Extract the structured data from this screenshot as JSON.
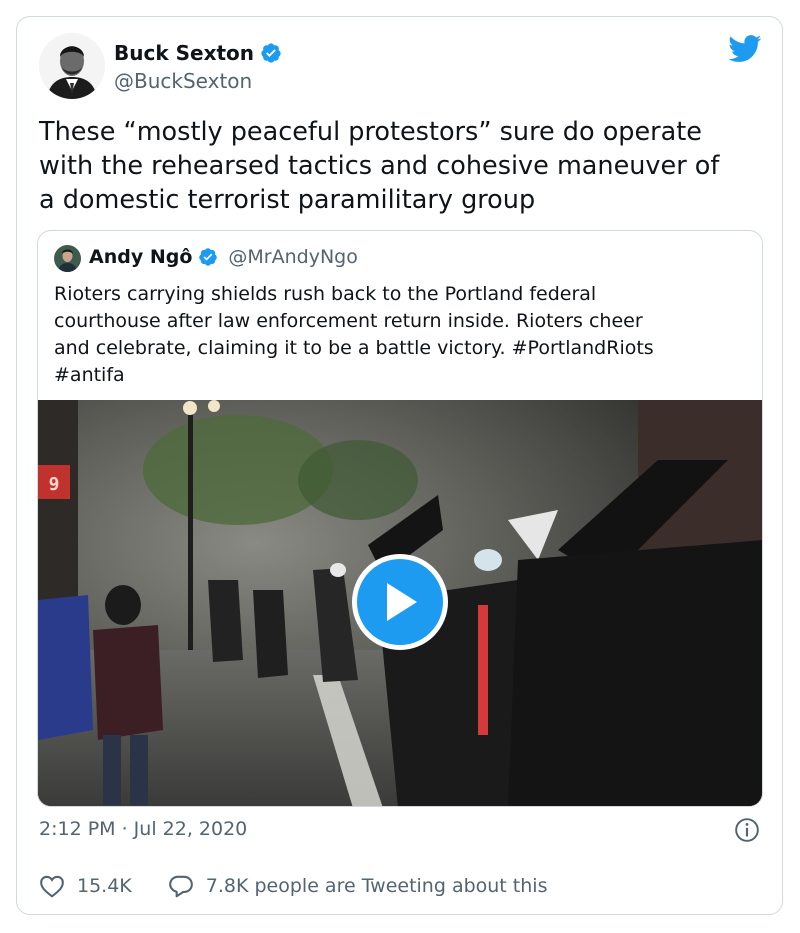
{
  "author": {
    "display_name": "Buck Sexton",
    "handle": "@BuckSexton",
    "verified": true,
    "avatar_icon": "avatar-photo"
  },
  "tweet": {
    "text": "These “mostly peaceful protestors” sure do operate\nwith the rehearsed  tactics and cohesive maneuver of\na domestic terrorist paramilitary group",
    "timestamp": "2:12 PM · Jul 22, 2020"
  },
  "quoted": {
    "display_name": "Andy Ngô",
    "handle": "@MrAndyNgo",
    "verified": true,
    "text": "Rioters carrying shields rush back to the Portland federal\ncourthouse after law enforcement return inside. Rioters cheer\nand celebrate, claiming it to be a battle victory. #PortlandRiots\n #antifa",
    "media_sign_text": "9"
  },
  "stats": {
    "likes": "15.4K",
    "conversation": "7.8K people are Tweeting about this"
  },
  "colors": {
    "brand_blue": "#1d9bf0",
    "muted": "#536471",
    "border": "#cfd9de"
  }
}
